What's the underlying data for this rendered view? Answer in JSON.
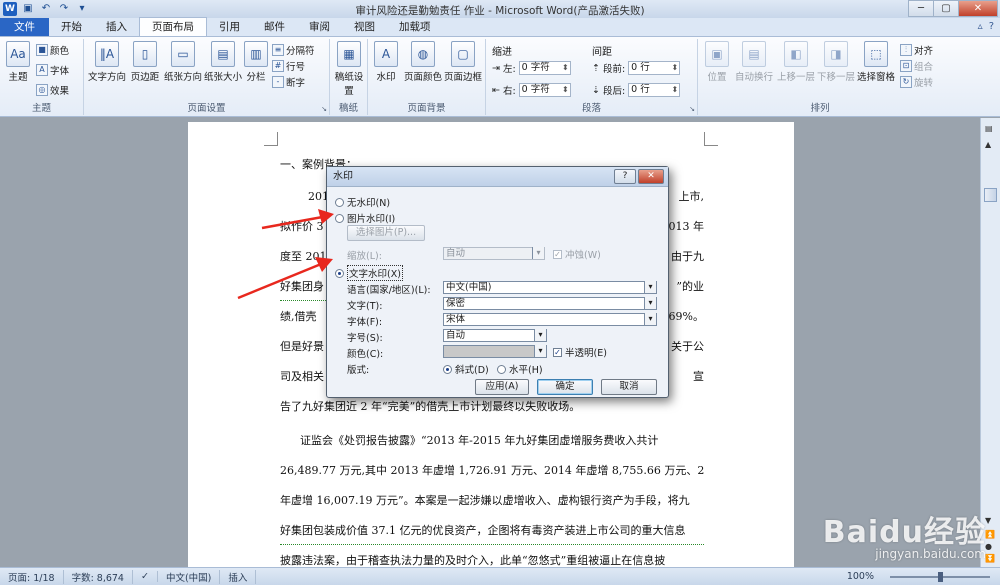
{
  "window": {
    "title": "审计风险还是勤勉责任 作业 - Microsoft Word(产品激活失败)"
  },
  "tabs": [
    "文件",
    "开始",
    "插入",
    "页面布局",
    "引用",
    "邮件",
    "审阅",
    "视图",
    "加载项"
  ],
  "active_tab": "页面布局",
  "ribbon": {
    "theme": {
      "label": "主题",
      "theme_btn": "主题",
      "colors": "颜色",
      "fonts": "字体",
      "effects": "效果"
    },
    "page_setup": {
      "label": "页面设置",
      "text_dir": "文字方向",
      "margins": "页边距",
      "orientation": "纸张方向",
      "size": "纸张大小",
      "columns": "分栏",
      "breaks": "分隔符",
      "line_numbers": "行号",
      "hyphenation": "断字"
    },
    "draft": {
      "label": "稿纸",
      "btn": "稿纸设置"
    },
    "background": {
      "label": "页面背景",
      "watermark": "水印",
      "page_color": "页面颜色",
      "page_border": "页面边框"
    },
    "paragraph": {
      "label": "段落",
      "indent_title": "缩进",
      "spacing_title": "间距",
      "left_label": "左:",
      "left_value": "0 字符",
      "right_label": "右:",
      "right_value": "0 字符",
      "before_label": "段前:",
      "before_value": "0 行",
      "after_label": "段后:",
      "after_value": "0 行"
    },
    "arrange": {
      "label": "排列",
      "position": "位置",
      "wrap": "自动换行",
      "forward": "上移一层",
      "backward": "下移一层",
      "selection": "选择窗格",
      "align": "对齐",
      "group": "组合",
      "rotate": "旋转"
    }
  },
  "document": {
    "heading": "一、案例背景：",
    "lines": [
      "2015",
      "上市,",
      "拟作价 3",
      "2013 年",
      "度至 201",
      "由于九",
      "好集团身",
      "”的业",
      "绩,借壳",
      "269%。",
      "但是好景",
      "关于公",
      "司及相关",
      "宣",
      "告了九好集团近 2 年“完美”的借壳上市计划最终以失败收场。",
      "证监会《处罚报告披露》“2013 年-2015 年九好集团虚增服务费收入共计",
      "26,489.77 万元,其中 2013 年虚增 1,726.91 万元、2014 年虚增 8,755.66 万元、2015",
      "年虚增 16,007.19 万元”。本案是一起涉嫌以虚增收入、虚构银行资产为手段，将九",
      "好集团包装成价值 37.1 亿元的优良资产，企图将有毒资产装进上市公司的重大信息",
      "披露违法案，由于稽查执法力量的及时介入，此单“忽悠式”重组被逼止在信息披"
    ]
  },
  "dialog": {
    "title": "水印",
    "no_watermark": "无水印(N)",
    "picture_watermark": "图片水印(I)",
    "select_picture": "选择图片(P)...",
    "scale_label": "缩放(L):",
    "scale_value": "自动",
    "washout": "冲蚀(W)",
    "text_watermark": "文字水印(X)",
    "language_label": "语言(国家/地区)(L):",
    "language_value": "中文(中国)",
    "text_label": "文字(T):",
    "text_value": "保密",
    "font_label": "字体(F):",
    "font_value": "宋体",
    "size_label": "字号(S):",
    "size_value": "自动",
    "color_label": "颜色(C):",
    "semitransparent": "半透明(E)",
    "layout_label": "版式:",
    "diagonal": "斜式(D)",
    "horizontal": "水平(H)",
    "apply": "应用(A)",
    "ok": "确定",
    "cancel": "取消"
  },
  "statusbar": {
    "page": "页面: 1/18",
    "words": "字数: 8,674",
    "language": "中文(中国)",
    "mode": "插入",
    "zoom": "100%"
  },
  "brand_watermark": {
    "line1": "Baidu经验",
    "line2": "jingyan.baidu.com"
  }
}
